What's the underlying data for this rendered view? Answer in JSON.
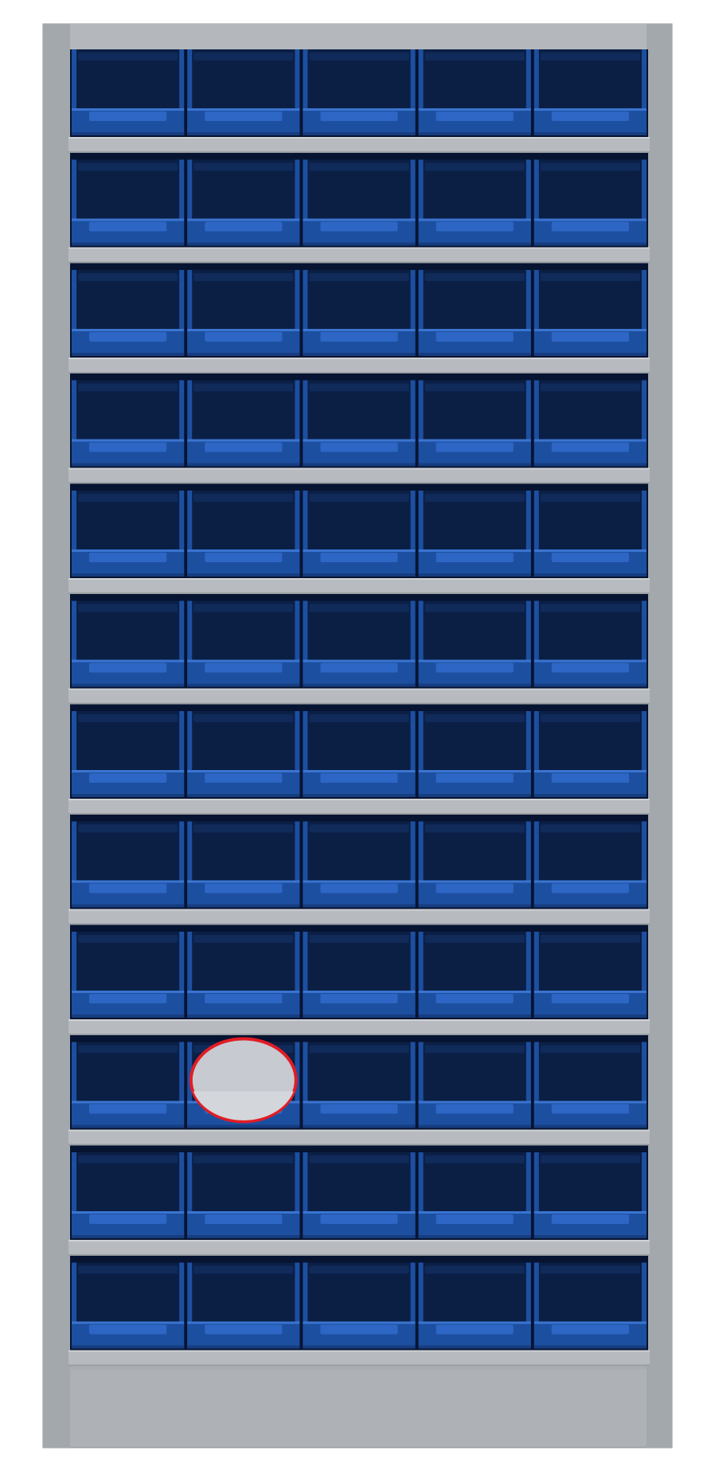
{
  "cabinet": {
    "rows": 12,
    "columns": 5,
    "frame_color": "#a9aeb3",
    "frame_edge_color": "#8d9297",
    "shelf_color": "#b7bbbf",
    "bin_color": "#1d4fa0",
    "bin_dark_color": "#0b1f45",
    "bin_shadow_color": "#061331",
    "bin_highlight_color": "#2d66c4"
  },
  "marker": {
    "row": 10,
    "column": 2,
    "fill": "#c7cad0",
    "stroke": "#e21c23"
  }
}
